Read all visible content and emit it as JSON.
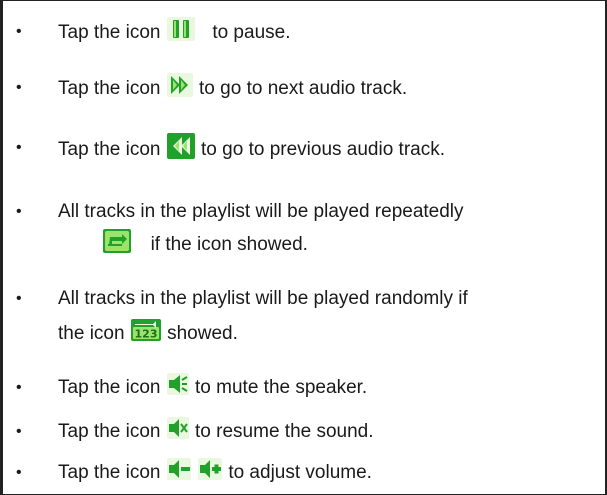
{
  "items": [
    {
      "before": "Tap the icon",
      "icon": "pause-icon",
      "after": "to pause."
    },
    {
      "before": "Tap the icon",
      "icon": "next-track-icon",
      "after": "to go to next audio track."
    },
    {
      "before": "Tap the icon",
      "icon": "previous-track-icon",
      "after": "to go to previous audio track."
    },
    {
      "line1": "All tracks in the playlist will be played repeatedly",
      "icon": "repeat-icon",
      "line2": "if the icon showed."
    },
    {
      "line1": "All tracks in the playlist will be played randomly if",
      "line2_before": "the icon",
      "icon": "shuffle-icon",
      "line2_after": "showed."
    },
    {
      "before": "Tap the icon",
      "icon": "mute-icon",
      "after": "to mute the speaker."
    },
    {
      "before": "Tap the icon",
      "icon": "resume-sound-icon",
      "after": "to resume the sound."
    },
    {
      "before": "Tap the icon",
      "icons": [
        "volume-down-icon",
        "volume-up-icon"
      ],
      "after": "to adjust volume."
    }
  ],
  "colors": {
    "icon_green": "#1fa12a",
    "icon_light": "#9be36a",
    "text": "#1a1a1a",
    "rule": "#222222"
  }
}
